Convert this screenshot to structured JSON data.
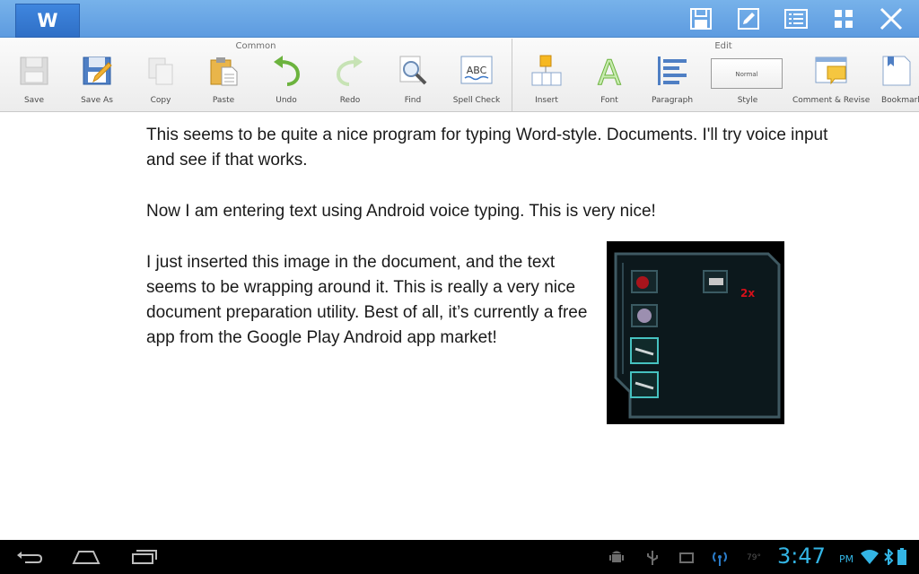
{
  "app": {
    "logo_letter": "W"
  },
  "titlebar": {
    "buttons": [
      "save-icon",
      "edit-icon",
      "list-icon",
      "grid-icon",
      "close-icon"
    ]
  },
  "ribbon": {
    "groups": {
      "common": "Common",
      "edit": "Edit"
    },
    "buttons": {
      "save": "Save",
      "save_as": "Save As",
      "copy": "Copy",
      "paste": "Paste",
      "undo": "Undo",
      "redo": "Redo",
      "find": "Find",
      "spell_check": "Spell Check",
      "insert": "Insert",
      "font": "Font",
      "paragraph": "Paragraph",
      "style": "Style",
      "comment_revise": "Comment & Revise",
      "bookmark": "Bookmark"
    },
    "style_value": "Normal",
    "spell_icon_text": "ABC",
    "font_icon_text": "A"
  },
  "document": {
    "paragraphs": [
      "This seems to be quite a nice program for typing Word-style. Documents. I'll try voice input and see if that works.",
      "Now I am entering text using Android voice typing. This is very nice!",
      "I just inserted this image in the document, and the text seems to be wrapping around it. This is really a very nice document preparation utility. Best of all, it’s currently a free app from the Google Play Android app market!"
    ],
    "image": {
      "badge": "2x"
    }
  },
  "statusbar": {
    "time": "3:47",
    "ampm": "PM",
    "temperature": "79°"
  },
  "colors": {
    "titlebar": "#5d9be0",
    "clock": "#33b5e5"
  }
}
